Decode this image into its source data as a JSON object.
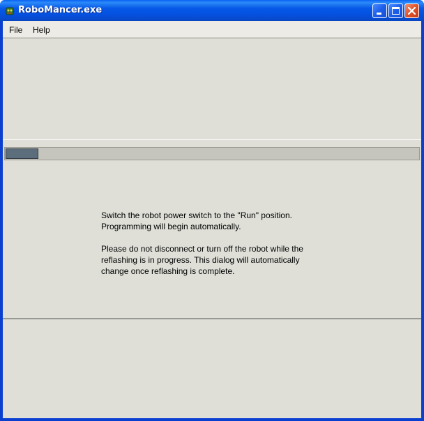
{
  "window": {
    "title": "RoboMancer.exe",
    "icon": "robot-app-icon",
    "controls": [
      "minimize-icon",
      "maximize-icon",
      "close-icon"
    ]
  },
  "menu": {
    "file": "File",
    "help": "Help"
  },
  "progress": {
    "fraction": 0.08
  },
  "message": {
    "line1": "Switch the robot power switch to the \"Run\" position.",
    "line2": "Programming will begin automatically.",
    "line3": "Please do not disconnect or turn off the robot while the",
    "line4": "reflashing is in progress. This dialog will automatically",
    "line5": "change once reflashing is complete."
  },
  "colors": {
    "titlebar": "#0758e8",
    "client": "#dfdfd8",
    "progress_fill": "#5c6d7b",
    "close_button": "#e0532a"
  }
}
